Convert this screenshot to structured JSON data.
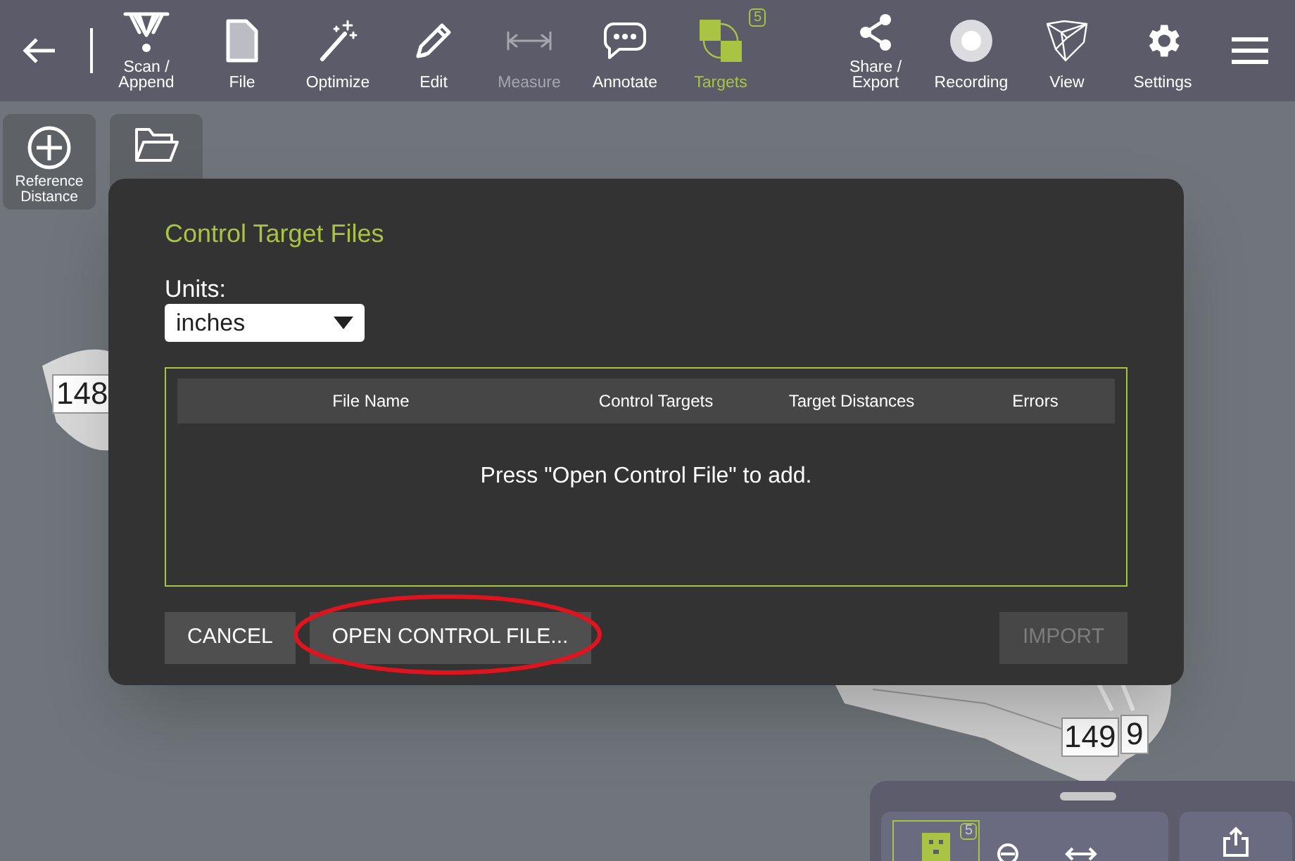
{
  "toolbar": {
    "items": [
      {
        "kind": "scan",
        "label": "Scan / Append",
        "selected": false,
        "disabled": false
      },
      {
        "kind": "file",
        "label": "File",
        "selected": false,
        "disabled": false
      },
      {
        "kind": "optimize",
        "label": "Optimize",
        "selected": false,
        "disabled": false
      },
      {
        "kind": "edit",
        "label": "Edit",
        "selected": false,
        "disabled": false
      },
      {
        "kind": "measure",
        "label": "Measure",
        "selected": false,
        "disabled": true
      },
      {
        "kind": "annotate",
        "label": "Annotate",
        "selected": false,
        "disabled": false
      },
      {
        "kind": "targets",
        "label": "Targets",
        "selected": true,
        "disabled": false,
        "badge": "5"
      },
      {
        "kind": "share",
        "label": "Share / Export",
        "selected": false,
        "disabled": false
      },
      {
        "kind": "recording",
        "label": "Recording",
        "selected": false,
        "disabled": false
      },
      {
        "kind": "view",
        "label": "View",
        "selected": false,
        "disabled": false
      },
      {
        "kind": "settings",
        "label": "Settings",
        "selected": false,
        "disabled": false
      }
    ]
  },
  "side_tools": [
    {
      "kind": "reference",
      "label": "Reference Distance"
    },
    {
      "kind": "load"
    }
  ],
  "canvas": {
    "labels": [
      "148",
      "149",
      "9"
    ]
  },
  "dialog": {
    "title": "Control Target Files",
    "units_label": "Units:",
    "units_value": "inches",
    "table": {
      "columns": [
        "File Name",
        "Control Targets",
        "Target Distances",
        "Errors"
      ],
      "empty_message": "Press \"Open Control File\" to add."
    },
    "buttons": [
      {
        "label": "CANCEL",
        "disabled": false
      },
      {
        "label": "OPEN CONTROL FILE...",
        "disabled": false,
        "highlighted": true
      },
      {
        "label": "IMPORT",
        "disabled": true
      }
    ]
  },
  "bottom_panel": {
    "badge": "5"
  }
}
